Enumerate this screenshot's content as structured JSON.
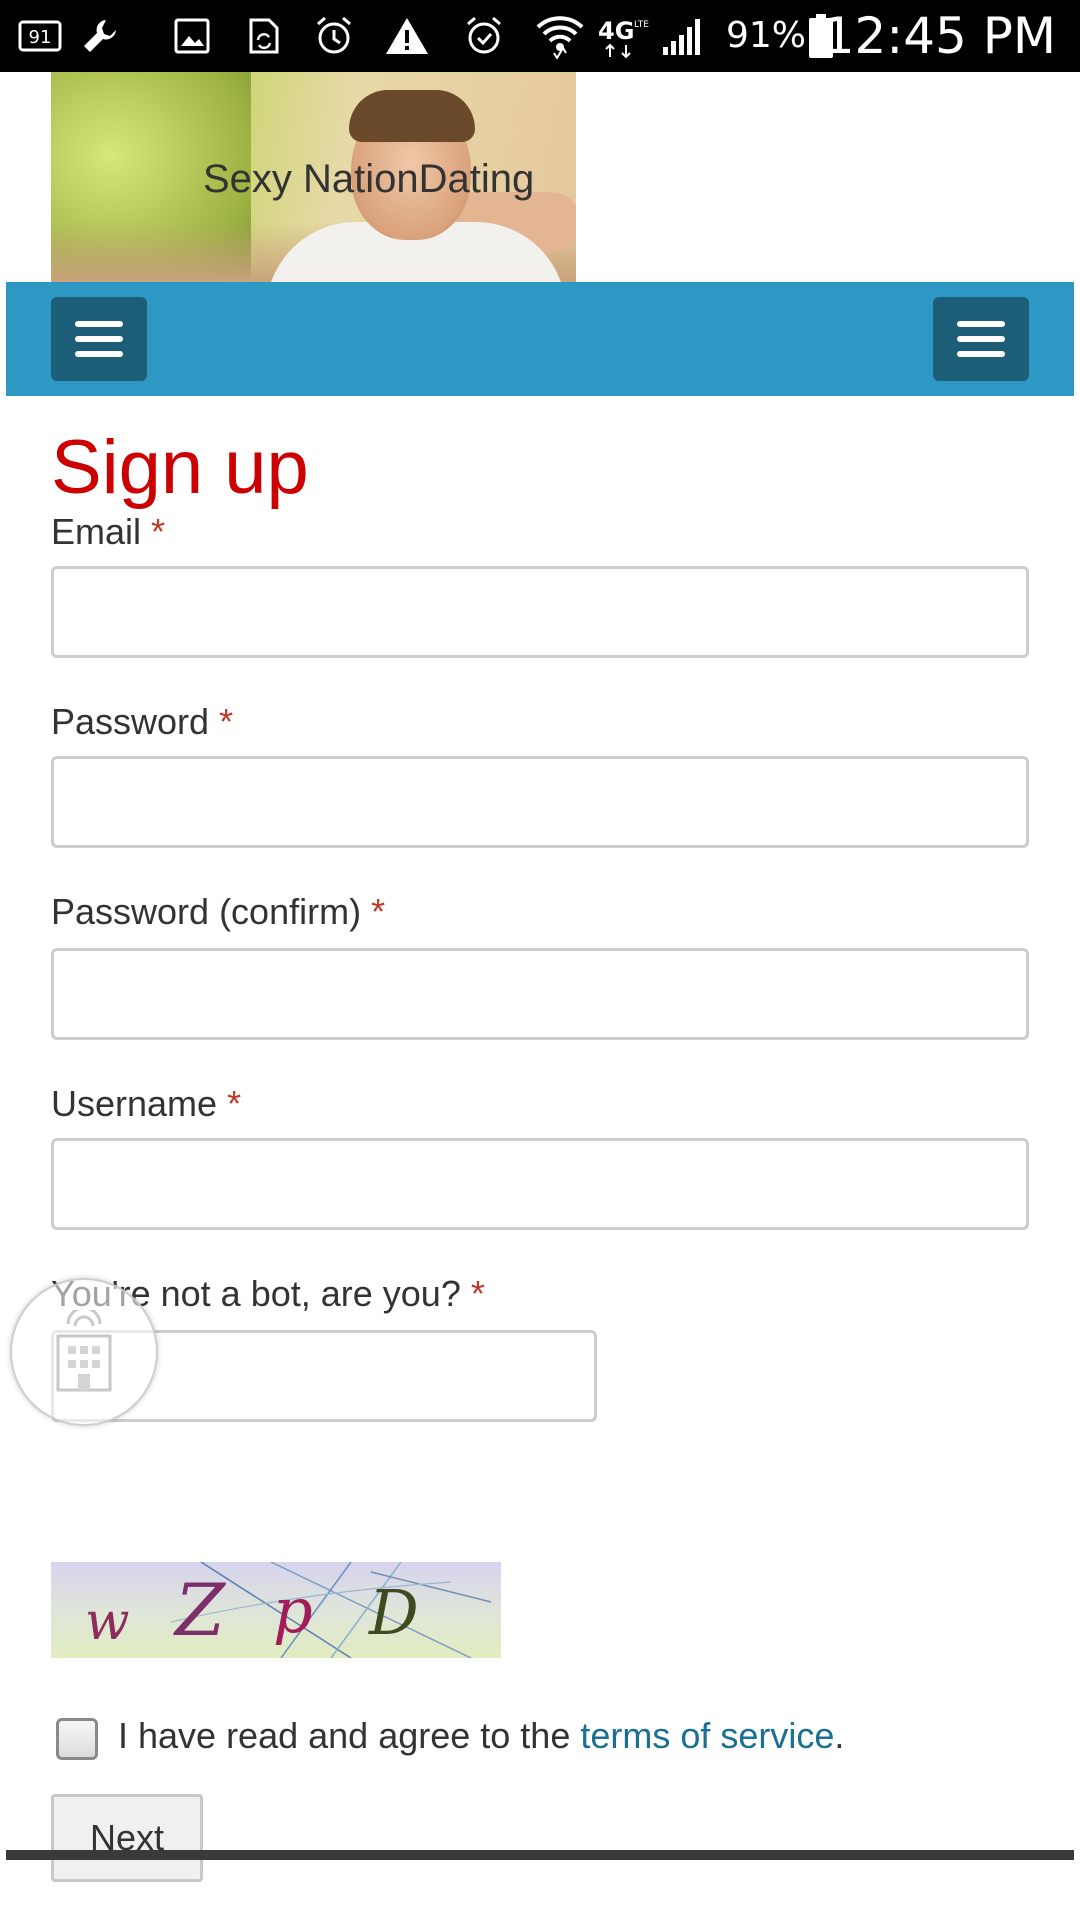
{
  "status_bar": {
    "battery_percent": "91%",
    "time": "12:45 PM",
    "network": "4G",
    "icons": [
      "notification-count-icon",
      "wrench-icon",
      "image-icon",
      "sync-icon",
      "alarm-icon",
      "warning-icon",
      "alarm-icon",
      "wifi-icon",
      "lte-icon",
      "signal-icon",
      "battery-icon"
    ]
  },
  "header": {
    "site_title": "Sexy NationDating"
  },
  "navbar": {
    "color": "#2e98c4",
    "toggle_color": "#1c5d77",
    "left_toggle_icon": "hamburger-menu-icon",
    "right_toggle_icon": "hamburger-menu-icon"
  },
  "form": {
    "title": "Sign up",
    "title_color": "#cc0000",
    "required_marker": "*",
    "fields": {
      "email": {
        "label": "Email",
        "value": ""
      },
      "password": {
        "label": "Password",
        "value": ""
      },
      "password_confirm": {
        "label": "Password (confirm)",
        "value": ""
      },
      "username": {
        "label": "Username",
        "value": ""
      },
      "captcha": {
        "label": "You're not a bot, are you?",
        "value": ""
      }
    },
    "captcha_chars": [
      "w",
      "Z",
      "p",
      "D"
    ],
    "terms": {
      "prefix": "I have read and agree to the ",
      "link_text": "terms of service",
      "suffix": ".",
      "checked": false
    },
    "submit_label": "Next"
  },
  "link_color": "#1a6f93"
}
